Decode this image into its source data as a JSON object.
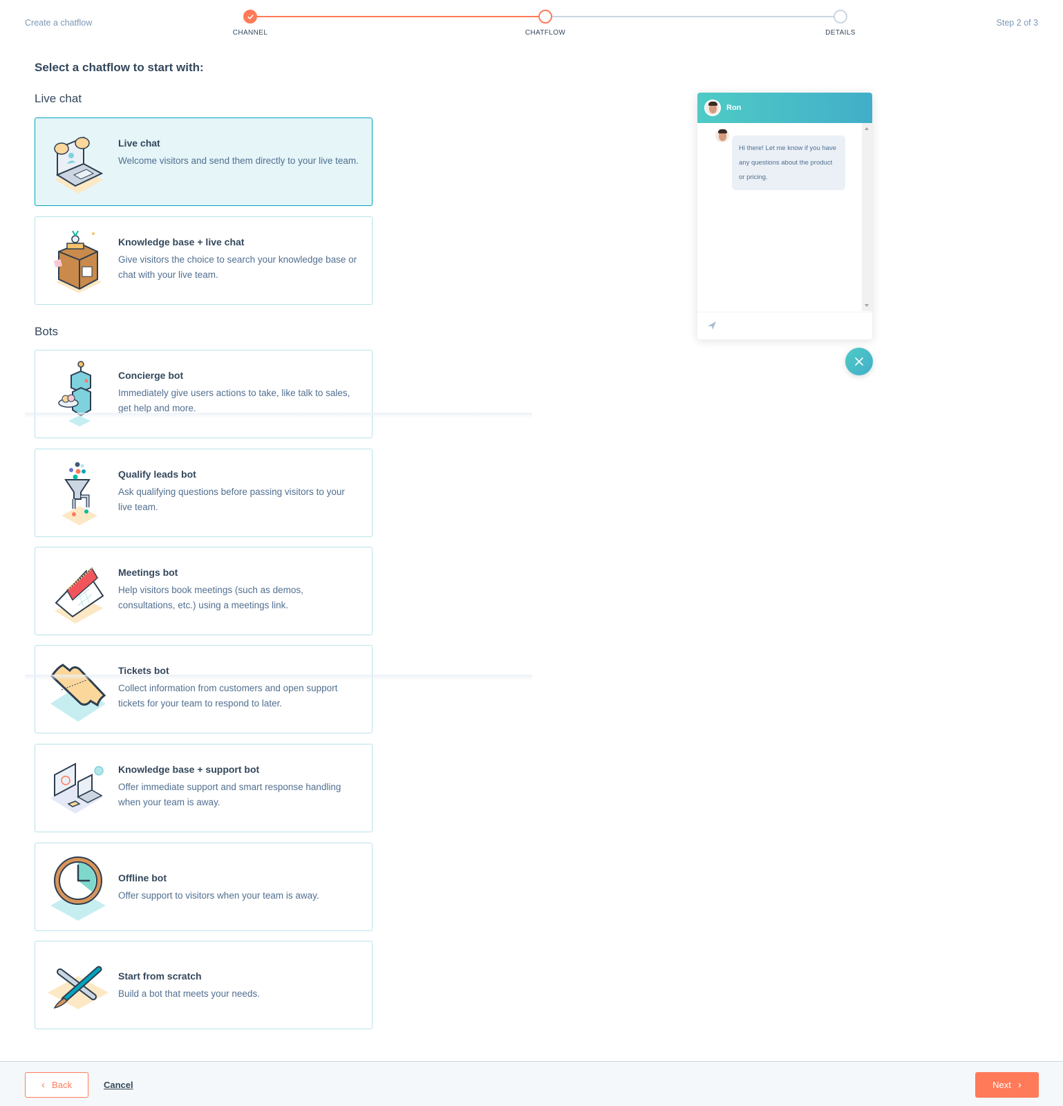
{
  "header": {
    "title": "Create a chatflow",
    "step_count": "Step 2 of 3",
    "steps": [
      {
        "label": "CHANNEL",
        "state": "done"
      },
      {
        "label": "CHATFLOW",
        "state": "current"
      },
      {
        "label": "DETAILS",
        "state": "todo"
      }
    ]
  },
  "main": {
    "heading": "Select a chatflow to start with:",
    "sections": [
      {
        "heading": "Live chat",
        "cards": [
          {
            "title": "Live chat",
            "description": "Welcome visitors and send them directly to your live team.",
            "icon": "laptop-chat-illustration",
            "selected": true
          },
          {
            "title": "Knowledge base + live chat",
            "description": "Give visitors the choice to search your knowledge base or chat with your live team.",
            "icon": "filing-cabinet-illustration",
            "selected": false
          }
        ]
      },
      {
        "heading": "Bots",
        "cards": [
          {
            "title": "Concierge bot",
            "description": "Immediately give users actions to take, like talk to sales, get help and more.",
            "icon": "robot-waiter-illustration",
            "selected": false
          },
          {
            "title": "Qualify leads bot",
            "description": "Ask qualifying questions before passing visitors to your live team.",
            "icon": "funnel-illustration",
            "selected": false
          },
          {
            "title": "Meetings bot",
            "description": "Help visitors book meetings (such as demos, consultations, etc.) using a meetings link.",
            "icon": "calendar-illustration",
            "selected": false
          },
          {
            "title": "Tickets bot",
            "description": "Collect information from customers and open support tickets for your team to respond to later.",
            "icon": "ticket-illustration",
            "selected": false
          },
          {
            "title": "Knowledge base + support bot",
            "description": "Offer immediate support and smart response handling when your team is away.",
            "icon": "devices-illustration",
            "selected": false
          },
          {
            "title": "Offline bot",
            "description": "Offer support to visitors when your team is away.",
            "icon": "clock-illustration",
            "selected": false
          },
          {
            "title": "Start from scratch",
            "description": "Build a bot that meets your needs.",
            "icon": "tools-illustration",
            "selected": false
          }
        ]
      }
    ]
  },
  "preview": {
    "agent_name": "Ron",
    "message": "Hi there! Let me know if you have any questions about the product or pricing.",
    "header_gradient": [
      "#4fcbc5",
      "#42aec9"
    ]
  },
  "footer": {
    "back_label": "Back",
    "cancel_label": "Cancel",
    "next_label": "Next"
  },
  "colors": {
    "accent": "#ff7a59",
    "selected_border": "#00a4bd",
    "selected_bg": "#e5f5f8",
    "text": "#33475b"
  }
}
